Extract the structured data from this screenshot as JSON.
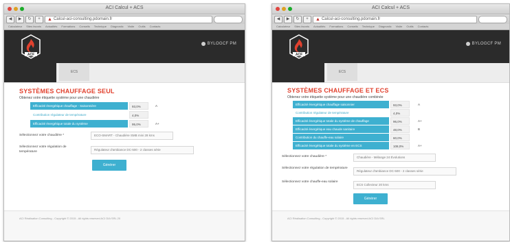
{
  "colors": {
    "accent": "#3eb0d0",
    "title_red": "#e1412e",
    "header_dark": "#2b2b2b"
  },
  "left": {
    "window_title": "ACI Calcul + ACS",
    "url": "Calcul-aci-consulting.pdomain.fr",
    "search_placeholder": "",
    "bookmarks": [
      "Calculateur",
      "Sites favoris",
      "Actualités",
      "Formations",
      "Conseils",
      "Technique",
      "Diagnostic",
      "Visite",
      "Outils",
      "Contacts"
    ],
    "user_text": "BYLOGCF PM",
    "nav_tab": "ECS",
    "title": "SYSTÈMES CHAUFFAGE SEUL",
    "subtitle": "Obtenez votre étiquette système pour une chaudière",
    "rows": [
      {
        "label": "Efficacité énergétique chauffage - Saisonnière",
        "value": "93,0%",
        "unit": "A",
        "style": "dark"
      },
      {
        "label": "Contribution régulateur de température",
        "value": "4,0%",
        "unit": "",
        "style": "light"
      },
      {
        "label": "Efficacité énergétique totale du système",
        "value": "95,0%",
        "unit": "A+",
        "style": "dark"
      }
    ],
    "form": [
      {
        "label": "Sélectionnez votre chaudière *",
        "value": "ECO-SMART - Chaudière SMB mini 28 kms"
      },
      {
        "label": "Sélectionnez votre régulation de température",
        "value": "Régulateur d'ambiance DC-500 - 2 classes série"
      }
    ],
    "submit": "Générer",
    "footer": "ACI Réalisation Consulting - Copyright © 2015 - All rights reserved ACI DIA SRL 20"
  },
  "right": {
    "window_title": "ACI Calcul + ACS",
    "url": "Calcul-aci-consulting.pdomain.fr",
    "bookmarks": [
      "Calculateur",
      "Sites favoris",
      "Actualités",
      "Formations",
      "Conseils",
      "Technique",
      "Diagnostic",
      "Visite",
      "Outils",
      "Contacts"
    ],
    "user_text": "BYLOGCF PM",
    "nav_tab": "ECS",
    "title": "SYSTÈMES CHAUFFAGE ET ECS",
    "subtitle": "Obtenez votre étiquette système pour une chaudière combinée",
    "rows": [
      {
        "label": "Efficacité énergétique chauffage saisonnier",
        "value": "93,0%",
        "unit": "A",
        "style": "dark"
      },
      {
        "label": "Contribution régulateur de température",
        "value": "4,0%",
        "unit": "",
        "style": "light"
      },
      {
        "label": "Efficacité énergétique totale du système de chauffage",
        "value": "96,0%",
        "unit": "A+",
        "style": "dark"
      },
      {
        "label": "Efficacité énergétique eau chaude sanitaire",
        "value": "48,0%",
        "unit": "B",
        "style": "dark"
      },
      {
        "label": "Contribution du chauffe-eau solaire",
        "value": "60,0%",
        "unit": "",
        "style": "dark"
      },
      {
        "label": "Efficacité énergétique totale du système en ECS",
        "value": "108,0%",
        "unit": "A+",
        "style": "dark"
      }
    ],
    "form": [
      {
        "label": "Sélectionnez votre chaudière *",
        "value": "Chaudière - Mélange 24 Évolutions"
      },
      {
        "label": "Sélectionnez votre régulation de température",
        "value": "Régulateur d'ambiance DC-500 - 2 classes série"
      },
      {
        "label": "Sélectionnez votre chauffe-eau solaire",
        "value": "ECS Collecteur 20 kms"
      }
    ],
    "submit": "Générer",
    "footer": "ACI Réalisation Consulting - Copyright © 2015 - All rights reserved ACI DIA SRL"
  }
}
